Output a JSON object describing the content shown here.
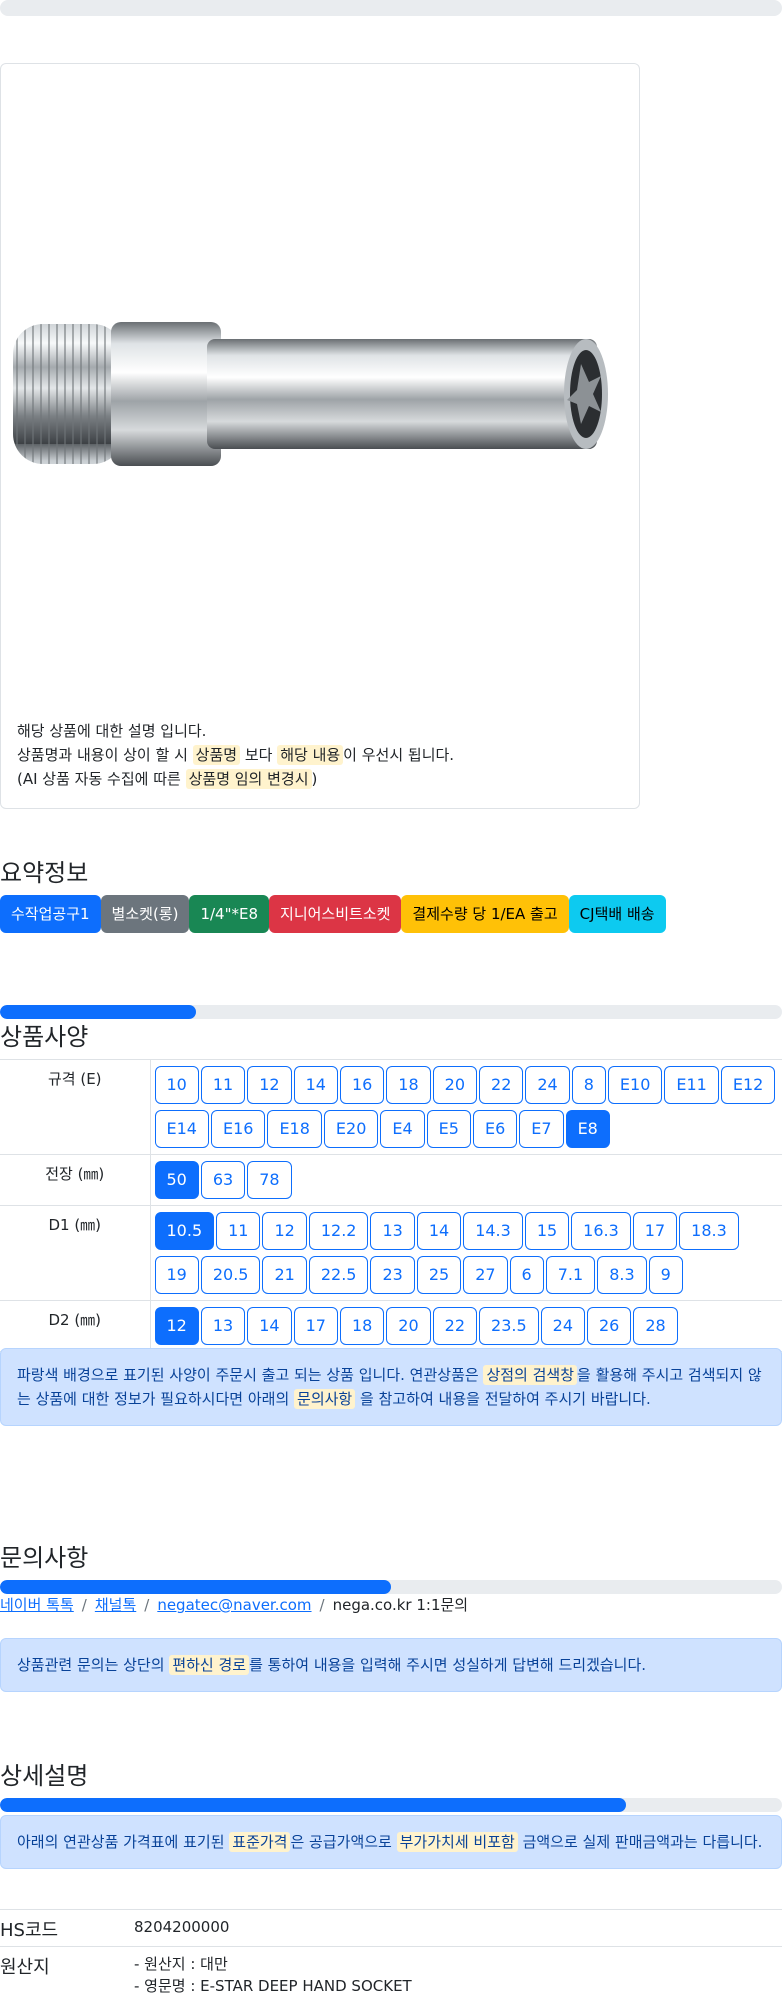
{
  "card_note": {
    "line1": "해당 상품에 대한 설명 입니다.",
    "line2_a": "상품명과 내용이 상이 할 시 ",
    "line2_hl1": "상품명",
    "line2_b": " 보다 ",
    "line2_hl2": "해당 내용",
    "line2_c": "이 우선시 됩니다.",
    "line3_a": "(AI 상품 자동 수집에 따른 ",
    "line3_hl": "상품명 임의 변경시",
    "line3_b": ")"
  },
  "summary": {
    "title": "요약정보",
    "badges": [
      "수작업공구1",
      "별소켓(롱)",
      "1/4\"*E8",
      "지니어스비트소켓",
      "결제수량 당 1/EA 출고",
      "CJ택배 배송"
    ],
    "badge_colors": [
      "#0d6efd",
      "#6c757d",
      "#198754",
      "#dc3545",
      "#ffc107",
      "#0dcaf0"
    ]
  },
  "specs": {
    "title": "상품사양",
    "progress": 0.25,
    "rows": [
      {
        "label": "규격 (E)",
        "options": [
          "10",
          "11",
          "12",
          "14",
          "16",
          "18",
          "20",
          "22",
          "24",
          "8",
          "E10",
          "E11",
          "E12",
          "E14",
          "E16",
          "E18",
          "E20",
          "E4",
          "E5",
          "E6",
          "E7",
          "E8"
        ],
        "selected": "E8"
      },
      {
        "label": "전장 (㎜)",
        "options": [
          "50",
          "63",
          "78"
        ],
        "selected": "50"
      },
      {
        "label": "D1 (㎜)",
        "options": [
          "10.5",
          "11",
          "12",
          "12.2",
          "13",
          "14",
          "14.3",
          "15",
          "16.3",
          "17",
          "18.3",
          "19",
          "20.5",
          "21",
          "22.5",
          "23",
          "25",
          "27",
          "6",
          "7.1",
          "8.3",
          "9"
        ],
        "selected": "10.5"
      },
      {
        "label": "D2 (㎜)",
        "options": [
          "12",
          "13",
          "14",
          "17",
          "18",
          "20",
          "22",
          "23.5",
          "24",
          "26",
          "28"
        ],
        "selected": "12"
      }
    ],
    "alert": {
      "a": "파랑색 배경으로 표기된 사양이 주문시 출고 되는 상품 입니다. 연관상품은 ",
      "hl1": "상점의 검색창",
      "b": "을 활용해 주시고 검색되지 않는 상품에 대한 정보가 필요하시다면 아래의 ",
      "hl2": "문의사항",
      "c": " 을 참고하여 내용을 전달하여 주시기 바랍니다."
    }
  },
  "inquiry": {
    "title": "문의사항",
    "progress": 0.5,
    "links": [
      "네이버 톡톡",
      "채널톡",
      "negatec@naver.com"
    ],
    "plain": "nega.co.kr 1:1문의",
    "alert": {
      "a": "상품관련 문의는 상단의 ",
      "hl": "편하신 경로",
      "b": "를 통하여 내용을 입력해 주시면 성실하게 답변해 드리겠습니다."
    }
  },
  "detail": {
    "title": "상세설명",
    "progress": 0.8,
    "alert": {
      "a": "아래의 연관상품 가격표에 표기된 ",
      "hl1": "표준가격",
      "b": "은 공급가액으로 ",
      "hl2": "부가가치세 비포함",
      "c": " 금액으로 실제 판매금액과는 다릅니다."
    }
  },
  "info": {
    "hs_key": "HS코드",
    "hs_val": "8204200000",
    "origin_key": "원산지",
    "origin_line1": "- 원산지 : 대만",
    "origin_line2": "- 영문명 : E-STAR DEEP HAND SOCKET"
  }
}
